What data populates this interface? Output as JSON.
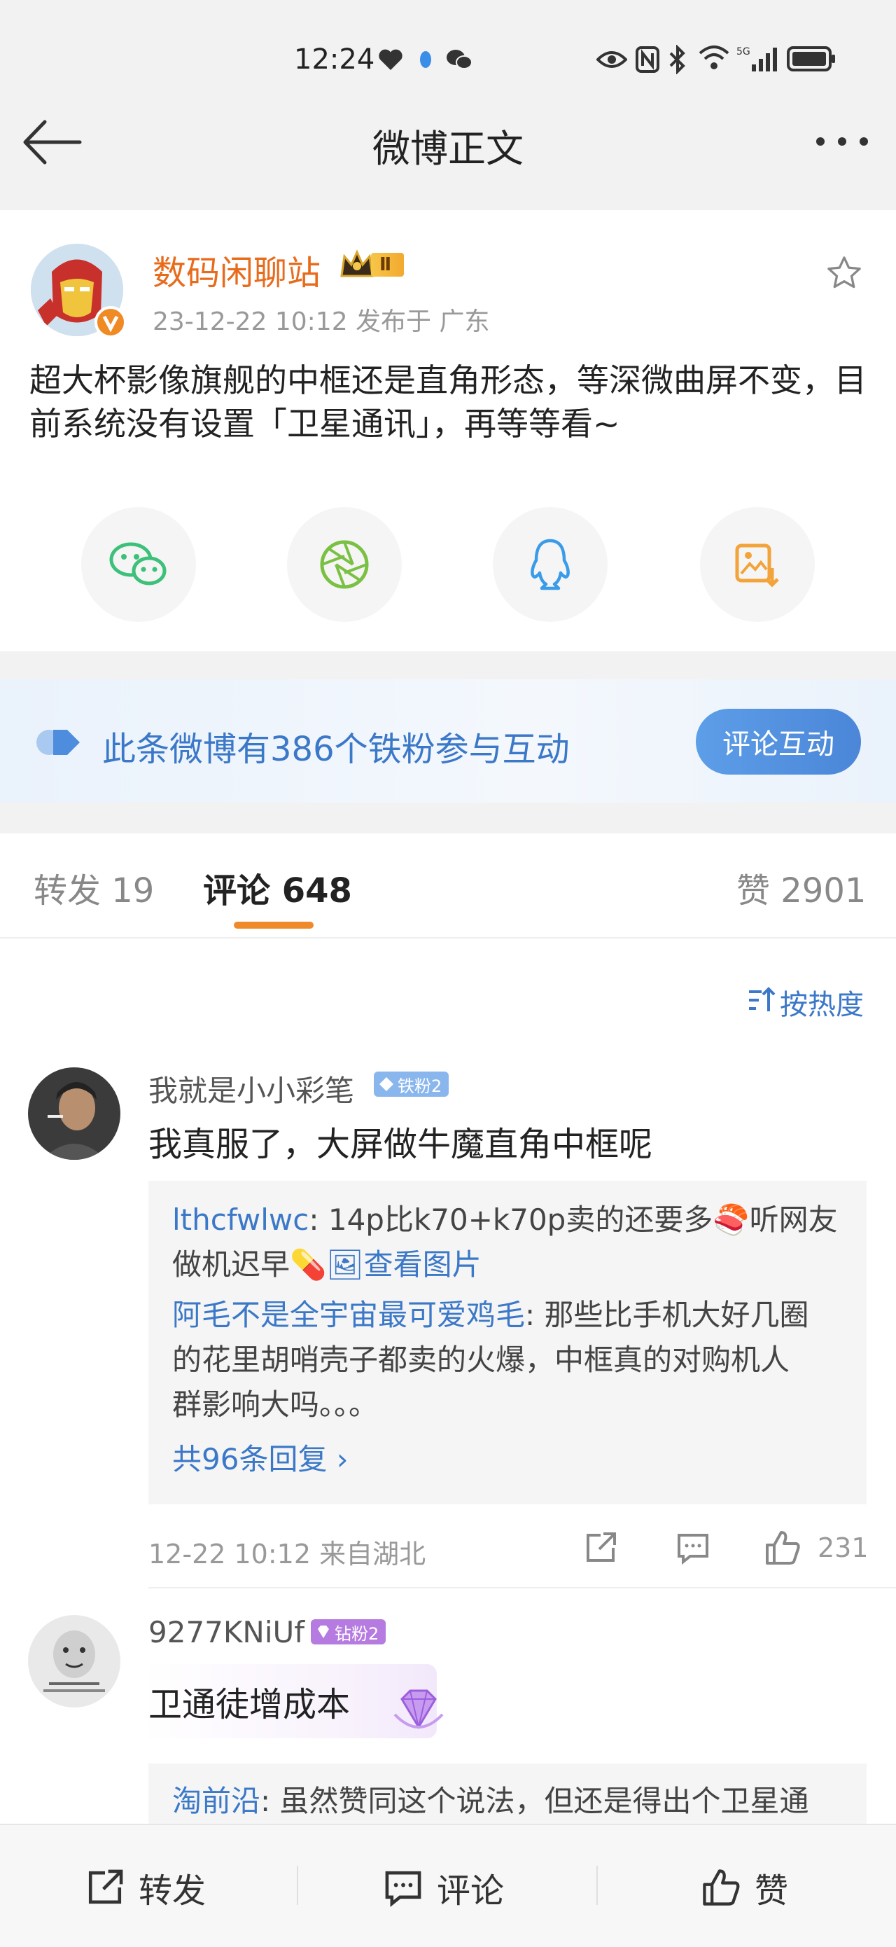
{
  "status": {
    "time": "12:24"
  },
  "nav": {
    "title": "微博正文"
  },
  "post": {
    "author": "数码闲聊站",
    "level_badge": "Ⅱ",
    "meta": "23-12-22 10:12  发布于 广东",
    "text": "超大杯影像旗舰的中框还是直角形态，等深微曲屏不变，目前系统没有设置「卫星通讯」，再等等看~",
    "share_icons": [
      "wechat-icon",
      "moments-icon",
      "qq-icon",
      "save-image-icon"
    ]
  },
  "fans": {
    "text": "此条微博有386个铁粉参与互动",
    "button": "评论互动"
  },
  "tabs": {
    "repost": "转发 19",
    "comment": "评论 648",
    "like": "赞 2901"
  },
  "sort": {
    "label": "按热度"
  },
  "comments": [
    {
      "user": "我就是小小彩笔",
      "badge": "铁粉2",
      "text": "我真服了，大屏做牛魔直角中框呢",
      "replies": [
        {
          "user": "lthcfwlwc",
          "text1": ": 14p比k70+k70p卖的还要多",
          "text2": "听网友",
          "text3": "做机迟早",
          "link": "查看图片"
        },
        {
          "user": "阿毛不是全宇宙最可爱鸡毛",
          "text1": ": 那些比手机大好几圈",
          "text2": "的花里胡哨壳子都卖的火爆，中框真的对购机人",
          "text3": "群影响大吗。。。"
        }
      ],
      "more": "共96条回复 ›",
      "time": "12-22 10:12  来自湖北",
      "likes": "231"
    },
    {
      "user": "9277KNiUf",
      "badge": "钻粉2",
      "text": "卫通徒增成本",
      "reply_user": "淘前沿",
      "reply_text": ": 虽然赞同这个说法，但还是得出个卫星通"
    }
  ],
  "bottom": {
    "repost": "转发",
    "comment": "评论",
    "like": "赞"
  },
  "colors": {
    "orange": "#e86b1c",
    "blue": "#3b78c8",
    "accent": "#ef8a2a"
  }
}
